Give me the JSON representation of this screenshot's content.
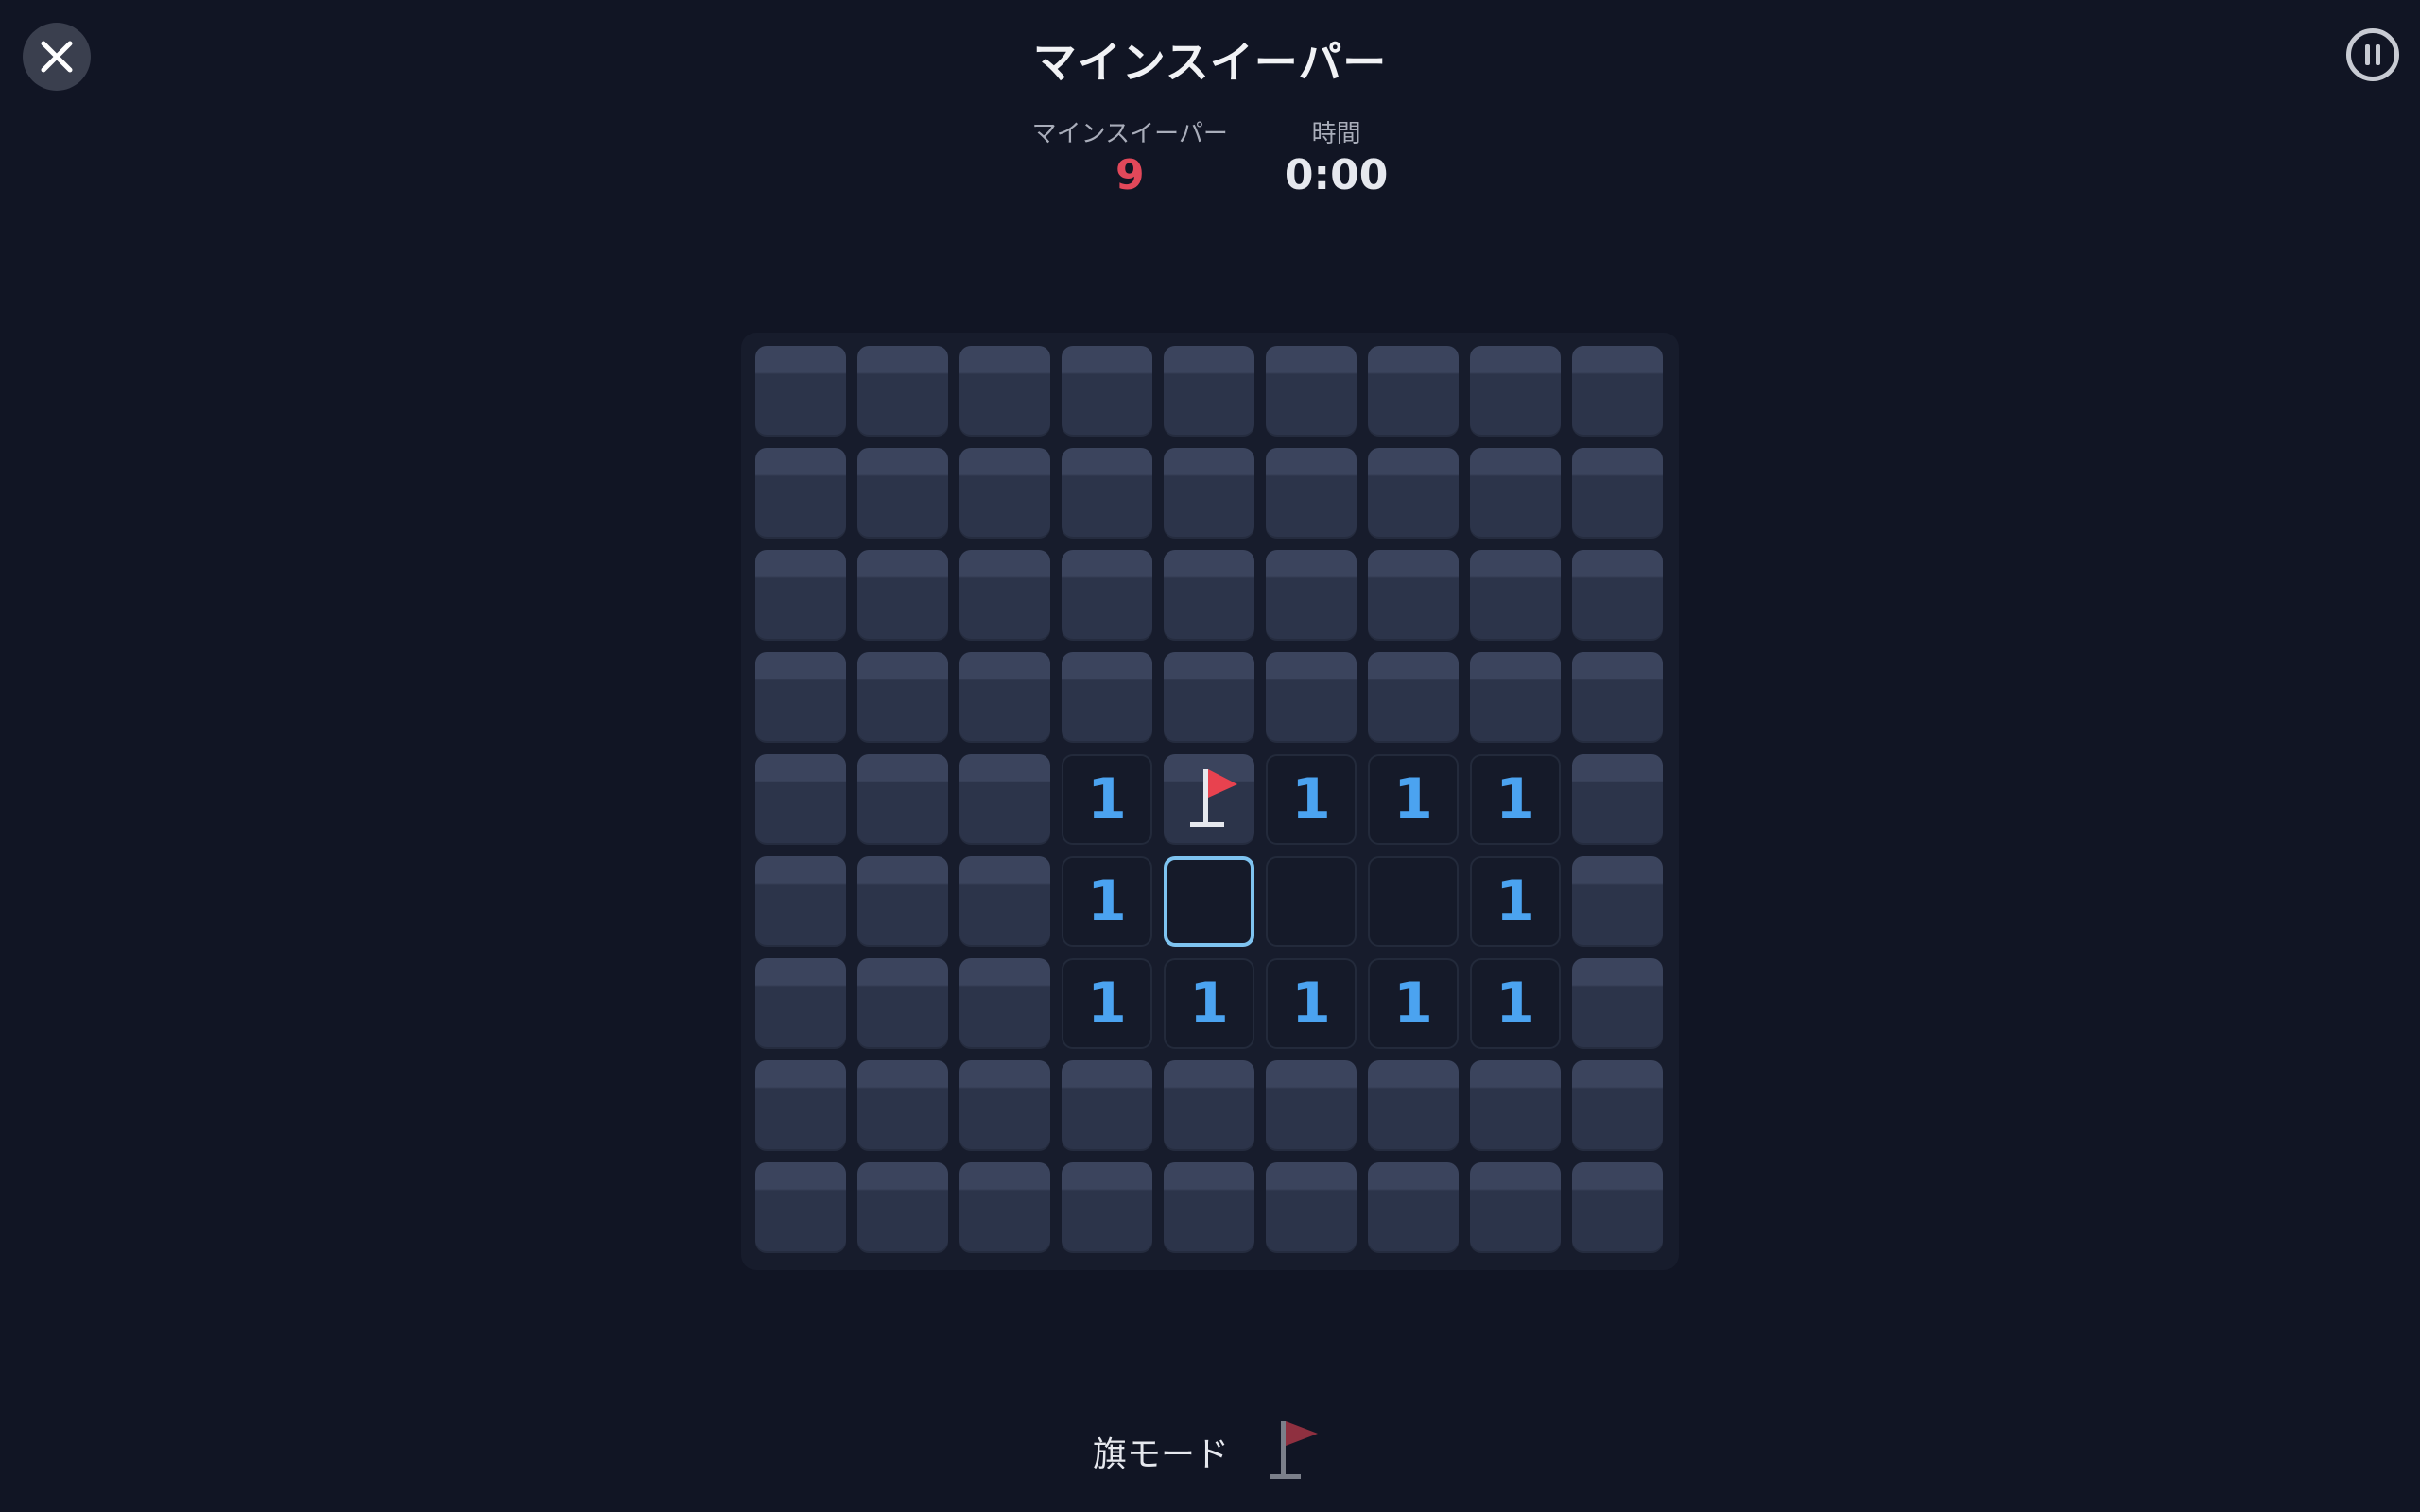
{
  "header": {
    "title": "マインスイーパー"
  },
  "stats": {
    "mines_label": "マインスイーパー",
    "mines_value": "9",
    "time_label": "時間",
    "time_value": "0:00"
  },
  "board": {
    "rows": 9,
    "cols": 9,
    "cells": [
      [
        "H",
        "H",
        "H",
        "H",
        "H",
        "H",
        "H",
        "H",
        "H"
      ],
      [
        "H",
        "H",
        "H",
        "H",
        "H",
        "H",
        "H",
        "H",
        "H"
      ],
      [
        "H",
        "H",
        "H",
        "H",
        "H",
        "H",
        "H",
        "H",
        "H"
      ],
      [
        "H",
        "H",
        "H",
        "H",
        "H",
        "H",
        "H",
        "H",
        "H"
      ],
      [
        "H",
        "H",
        "H",
        "1",
        "F",
        "1",
        "1",
        "1",
        "H"
      ],
      [
        "H",
        "H",
        "H",
        "1",
        "S",
        "0",
        "0",
        "1",
        "H"
      ],
      [
        "H",
        "H",
        "H",
        "1",
        "1",
        "1",
        "1",
        "1",
        "H"
      ],
      [
        "H",
        "H",
        "H",
        "H",
        "H",
        "H",
        "H",
        "H",
        "H"
      ],
      [
        "H",
        "H",
        "H",
        "H",
        "H",
        "H",
        "H",
        "H",
        "H"
      ]
    ]
  },
  "footer": {
    "flag_mode_label": "旗モード"
  },
  "colors": {
    "number": "#4ba3f0",
    "flag": "#e8424f",
    "mines_counter": "#e2485a",
    "selected_border": "#7ec3f0"
  },
  "icons": {
    "close": "close-icon",
    "pause": "pause-icon",
    "flag": "flag-icon"
  }
}
